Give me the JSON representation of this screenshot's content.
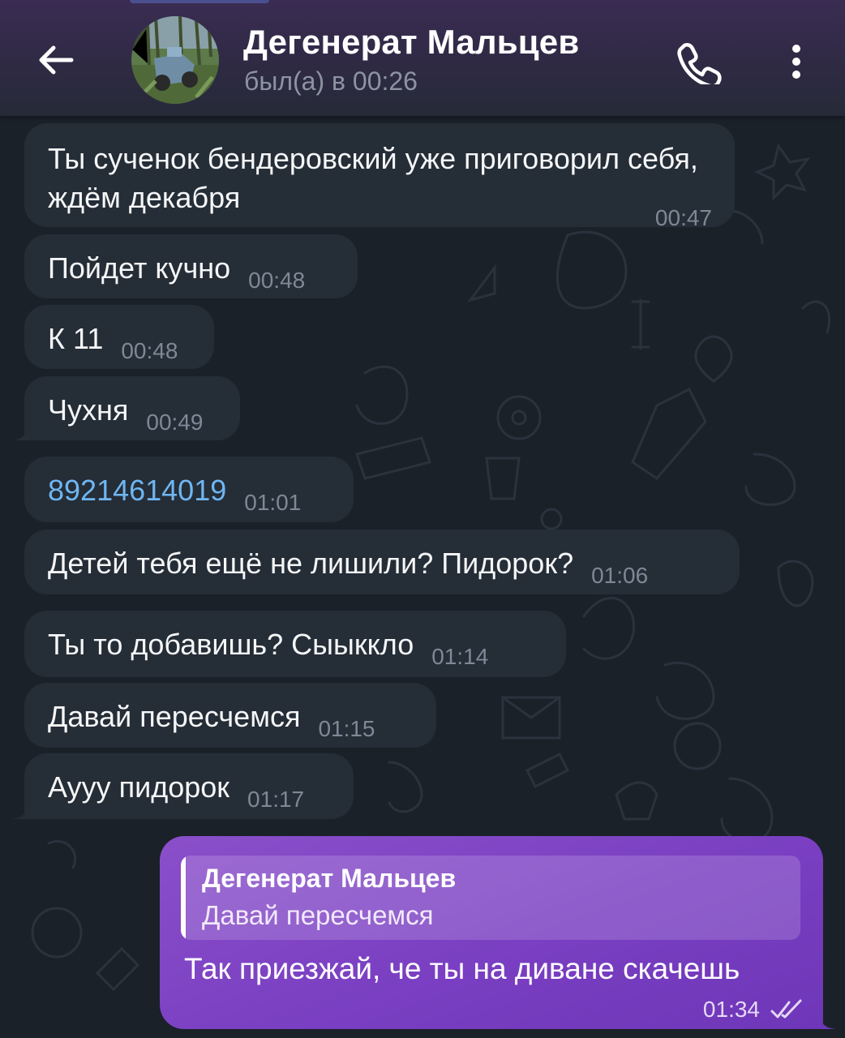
{
  "header": {
    "contact_name": "Дегенерат Мальцев",
    "last_seen": "был(а) в 00:26"
  },
  "messages": [
    {
      "text": "Ты сученок бендеровский уже приговорил себя, ждём декабря",
      "time": "00:47"
    },
    {
      "text": "Пойдет кучно",
      "time": "00:48"
    },
    {
      "text": "К 11",
      "time": "00:48"
    },
    {
      "text": "Чухня",
      "time": "00:49"
    },
    {
      "text": "89214614019",
      "time": "01:01",
      "is_link": true
    },
    {
      "text": "Детей тебя ещё не  лишили? Пидорок?",
      "time": "01:06"
    },
    {
      "text": "Ты то добавишь? Сыыккло",
      "time": "01:14"
    },
    {
      "text": "Давай пересчемся",
      "time": "01:15"
    },
    {
      "text": "Аууу пидорок",
      "time": "01:17"
    }
  ],
  "outgoing": {
    "reply_to_name": "Дегенерат Мальцев",
    "reply_to_text": "Давай пересчемся",
    "text": "Так приезжай, че ты на диване скачешь",
    "time": "01:34",
    "status": "read"
  },
  "colors": {
    "incoming_bubble": "#252d37",
    "outgoing_bubble": "#7a3fc2",
    "link": "#6fb6f2",
    "background": "#1a2129"
  }
}
